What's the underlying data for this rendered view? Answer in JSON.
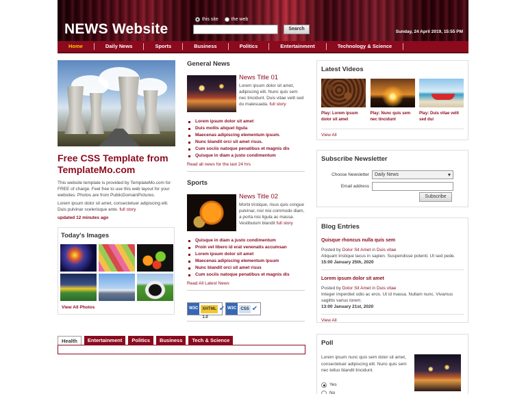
{
  "header": {
    "title": "NEWS Website",
    "radio_site": "this site",
    "radio_web": "the web",
    "search_button": "Search",
    "date": "Sunday, 24 April 2019, 15:55 PM"
  },
  "nav": {
    "items": [
      "Home",
      "Daily News",
      "Sports",
      "Business",
      "Politics",
      "Entertainment",
      "Technology & Science"
    ]
  },
  "feature": {
    "title": "Free CSS Template from TemplateMo.com",
    "paragraph1": "This website template is provided by TemplateMo.com for FREE of charge. Feel free to use this web layout for your websites. Photos are from PublicDomainPictures.",
    "paragraph2": "Lorem ipsum dolor sit amet, consectetuer adipiscing elit. Duis pulvinar scelerisque ante.",
    "full_story": "full story",
    "updated": "updated 12 minutes ago"
  },
  "todays_images": {
    "title": "Today's Images",
    "view_all": "View All Photos"
  },
  "tabs": [
    "Health",
    "Entertainment",
    "Politics",
    "Business",
    "Tech & Science"
  ],
  "general_news": {
    "title": "General News",
    "news_title": "News Title 01",
    "text": "Lorem ipsum dolor sit amet, adipiscing elit. Nunc quis sem nec tincidunt. Duis vitae velit sed du malesuada.",
    "full_story": "full story",
    "bullets": [
      "Lorem ipsum dolor sit amet",
      "Duis mollis aliquet ligula",
      "Maecenas adipiscing elementum ipsum.",
      "Nunc blandit orci sit amet risus.",
      "Cum sociis natoque penatibus et magnis dis",
      "Quisque in diam a justo condimentum"
    ],
    "read_all": "Read all news for the last 24 hrs"
  },
  "sports": {
    "title": "Sports",
    "news_title": "News Title 02",
    "text": "Morbi tristique, risus quis congue pulvinar, nisl nisi commodo diam, a porta nisi ligula ac massa. Vestibulum blandit",
    "full_story": "full story",
    "bullets": [
      "Quisque in diam a justo condimentum",
      "Proin vel libero id erat venenatis accumsan",
      "Lorem ipsum dolor sit amet",
      "Maecenas adipiscing elementum ipsum",
      "Nunc blandit orci sit amet risus",
      "Cum sociis natoque penatibus et magnis dis"
    ],
    "read_all": "Read All Latest News"
  },
  "badges": {
    "xhtml": "XHTML 1.0",
    "css": "CSS",
    "w3c": "W3C"
  },
  "videos": {
    "title": "Latest Videos",
    "items": [
      "Play: Lorem ipsum dolor sit amet",
      "Play: Nunc quis sem nec tincidunt",
      "Play: Duis vitae velit sed dui"
    ],
    "view_all": "View All"
  },
  "newsletter": {
    "title": "Subscribe Newsletter",
    "choose_label": "Choose Newsletter",
    "selected": "Daily News",
    "email_label": "Email address",
    "submit": "Subscribe"
  },
  "blog": {
    "title": "Blog Entries",
    "entries": [
      {
        "title": "Quisque rhoncus nulla quis sem",
        "posted_by": "Posted by",
        "author": "Dolor Sit Amet",
        "in": "in",
        "category": "Duis vitae",
        "text": "Aliquam tristique lacus in sapien. Suspendisse potenti. Ut sed pede.",
        "date": "15:00 January 25th, 2020"
      },
      {
        "title": "Lorem ipsum dolor sit amet",
        "posted_by": "Posted by",
        "author": "Dolor Sit Amet",
        "in": "in",
        "category": "Duis vitae",
        "text": "Integer imperdiet odio ac eros. Ut id massa. Nullam nunc. Vivamus sagittis varius lorem.",
        "date": "13:00 January 21st, 2020"
      }
    ],
    "view_all": "View All"
  },
  "poll": {
    "title": "Poll",
    "text": "Lorem ipsum nunc quis sem dolor sit amet, consectetuer adipiscing elit. Nunc quis sem nec tellus blandit tincidunt.",
    "options": [
      "Yes",
      "No"
    ]
  },
  "colors": {
    "brand": "#8b0a1e",
    "nav_active": "#ffcc00"
  }
}
